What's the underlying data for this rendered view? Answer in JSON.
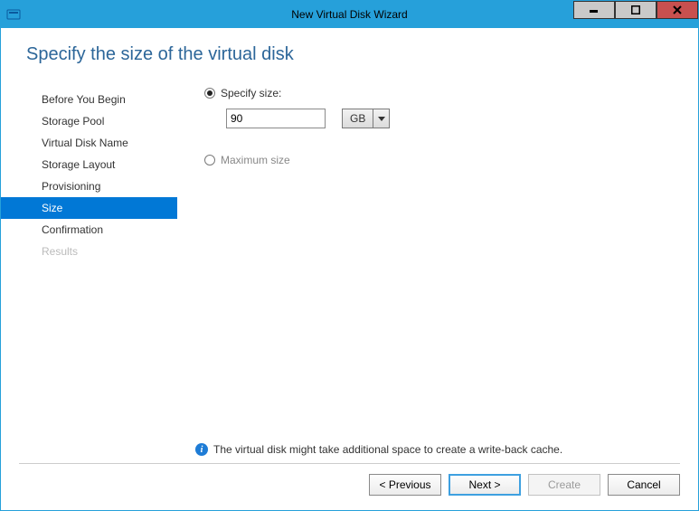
{
  "window": {
    "title": "New Virtual Disk Wizard"
  },
  "heading": "Specify the size of the virtual disk",
  "steps": [
    {
      "label": "Before You Begin",
      "state": "normal"
    },
    {
      "label": "Storage Pool",
      "state": "normal"
    },
    {
      "label": "Virtual Disk Name",
      "state": "normal"
    },
    {
      "label": "Storage Layout",
      "state": "normal"
    },
    {
      "label": "Provisioning",
      "state": "normal"
    },
    {
      "label": "Size",
      "state": "active"
    },
    {
      "label": "Confirmation",
      "state": "normal"
    },
    {
      "label": "Results",
      "state": "disabled"
    }
  ],
  "options": {
    "specify_label": "Specify size:",
    "specify_selected": true,
    "size_value": "90",
    "unit": "GB",
    "max_label": "Maximum size",
    "max_selected": false
  },
  "info_text": "The virtual disk might take additional space to create a write-back cache.",
  "buttons": {
    "previous": "< Previous",
    "next": "Next >",
    "create": "Create",
    "cancel": "Cancel"
  }
}
